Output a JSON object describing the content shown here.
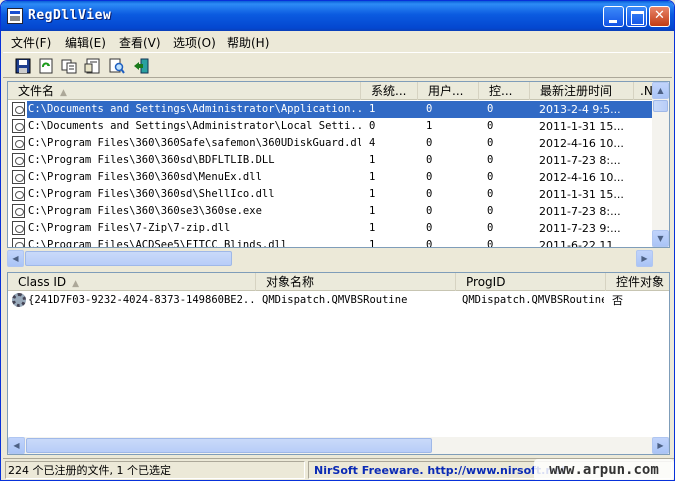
{
  "window": {
    "title": "RegDllView"
  },
  "menubar": {
    "items": [
      {
        "label": "文件(F)"
      },
      {
        "label": "编辑(E)"
      },
      {
        "label": "查看(V)"
      },
      {
        "label": "选项(O)"
      },
      {
        "label": "帮助(H)"
      }
    ]
  },
  "toolbar": {
    "icons": [
      "save-icon",
      "refresh-icon",
      "copy-icon",
      "properties-icon",
      "find-icon",
      "exit-icon"
    ]
  },
  "top_list": {
    "columns": [
      "文件名",
      "系统...",
      "用户...",
      "控...",
      "最新注册时间",
      ".NE"
    ],
    "rows": [
      [
        "C:\\Documents and Settings\\Administrator\\Application...",
        "1",
        "0",
        "0",
        "2013-2-4 9:5..."
      ],
      [
        "C:\\Documents and Settings\\Administrator\\Local Setti...",
        "0",
        "1",
        "0",
        "2011-1-31 15..."
      ],
      [
        "C:\\Program Files\\360\\360Safe\\safemon\\360UDiskGuard.dll",
        "4",
        "0",
        "0",
        "2012-4-16 10..."
      ],
      [
        "C:\\Program Files\\360\\360sd\\BDFLTLIB.DLL",
        "1",
        "0",
        "0",
        "2011-7-23 8:..."
      ],
      [
        "C:\\Program Files\\360\\360sd\\MenuEx.dll",
        "1",
        "0",
        "0",
        "2012-4-16 10..."
      ],
      [
        "C:\\Program Files\\360\\360sd\\ShellIco.dll",
        "1",
        "0",
        "0",
        "2011-1-31 15..."
      ],
      [
        "C:\\Program Files\\360\\360se3\\360se.exe",
        "1",
        "0",
        "0",
        "2011-7-23 8:..."
      ],
      [
        "C:\\Program Files\\7-Zip\\7-zip.dll",
        "1",
        "0",
        "0",
        "2011-7-23 9:..."
      ],
      [
        "C:\\Program Files\\ACDSee5\\EITCC Blinds.dll",
        "1",
        "0",
        "0",
        "2011-6-22 11..."
      ]
    ],
    "selected_index": 0
  },
  "bottom_list": {
    "columns": [
      "Class ID",
      "对象名称",
      "ProgID",
      "控件对象"
    ],
    "rows": [
      [
        "{241D7F03-9232-4024-8373-149860BE2...",
        "QMDispatch.QMVBSRoutine",
        "QMDispatch.QMVBSRoutine",
        "否"
      ]
    ]
  },
  "statusbar": {
    "left": "224 个已注册的文件, 1 个已选定",
    "right": "NirSoft Freeware.  http://www.nirsoft.net"
  },
  "watermark": "www.arpun.com",
  "colors": {
    "title_blue": "#0b5be0",
    "selection": "#316ac5",
    "link_blue": "#0a2ab5"
  }
}
